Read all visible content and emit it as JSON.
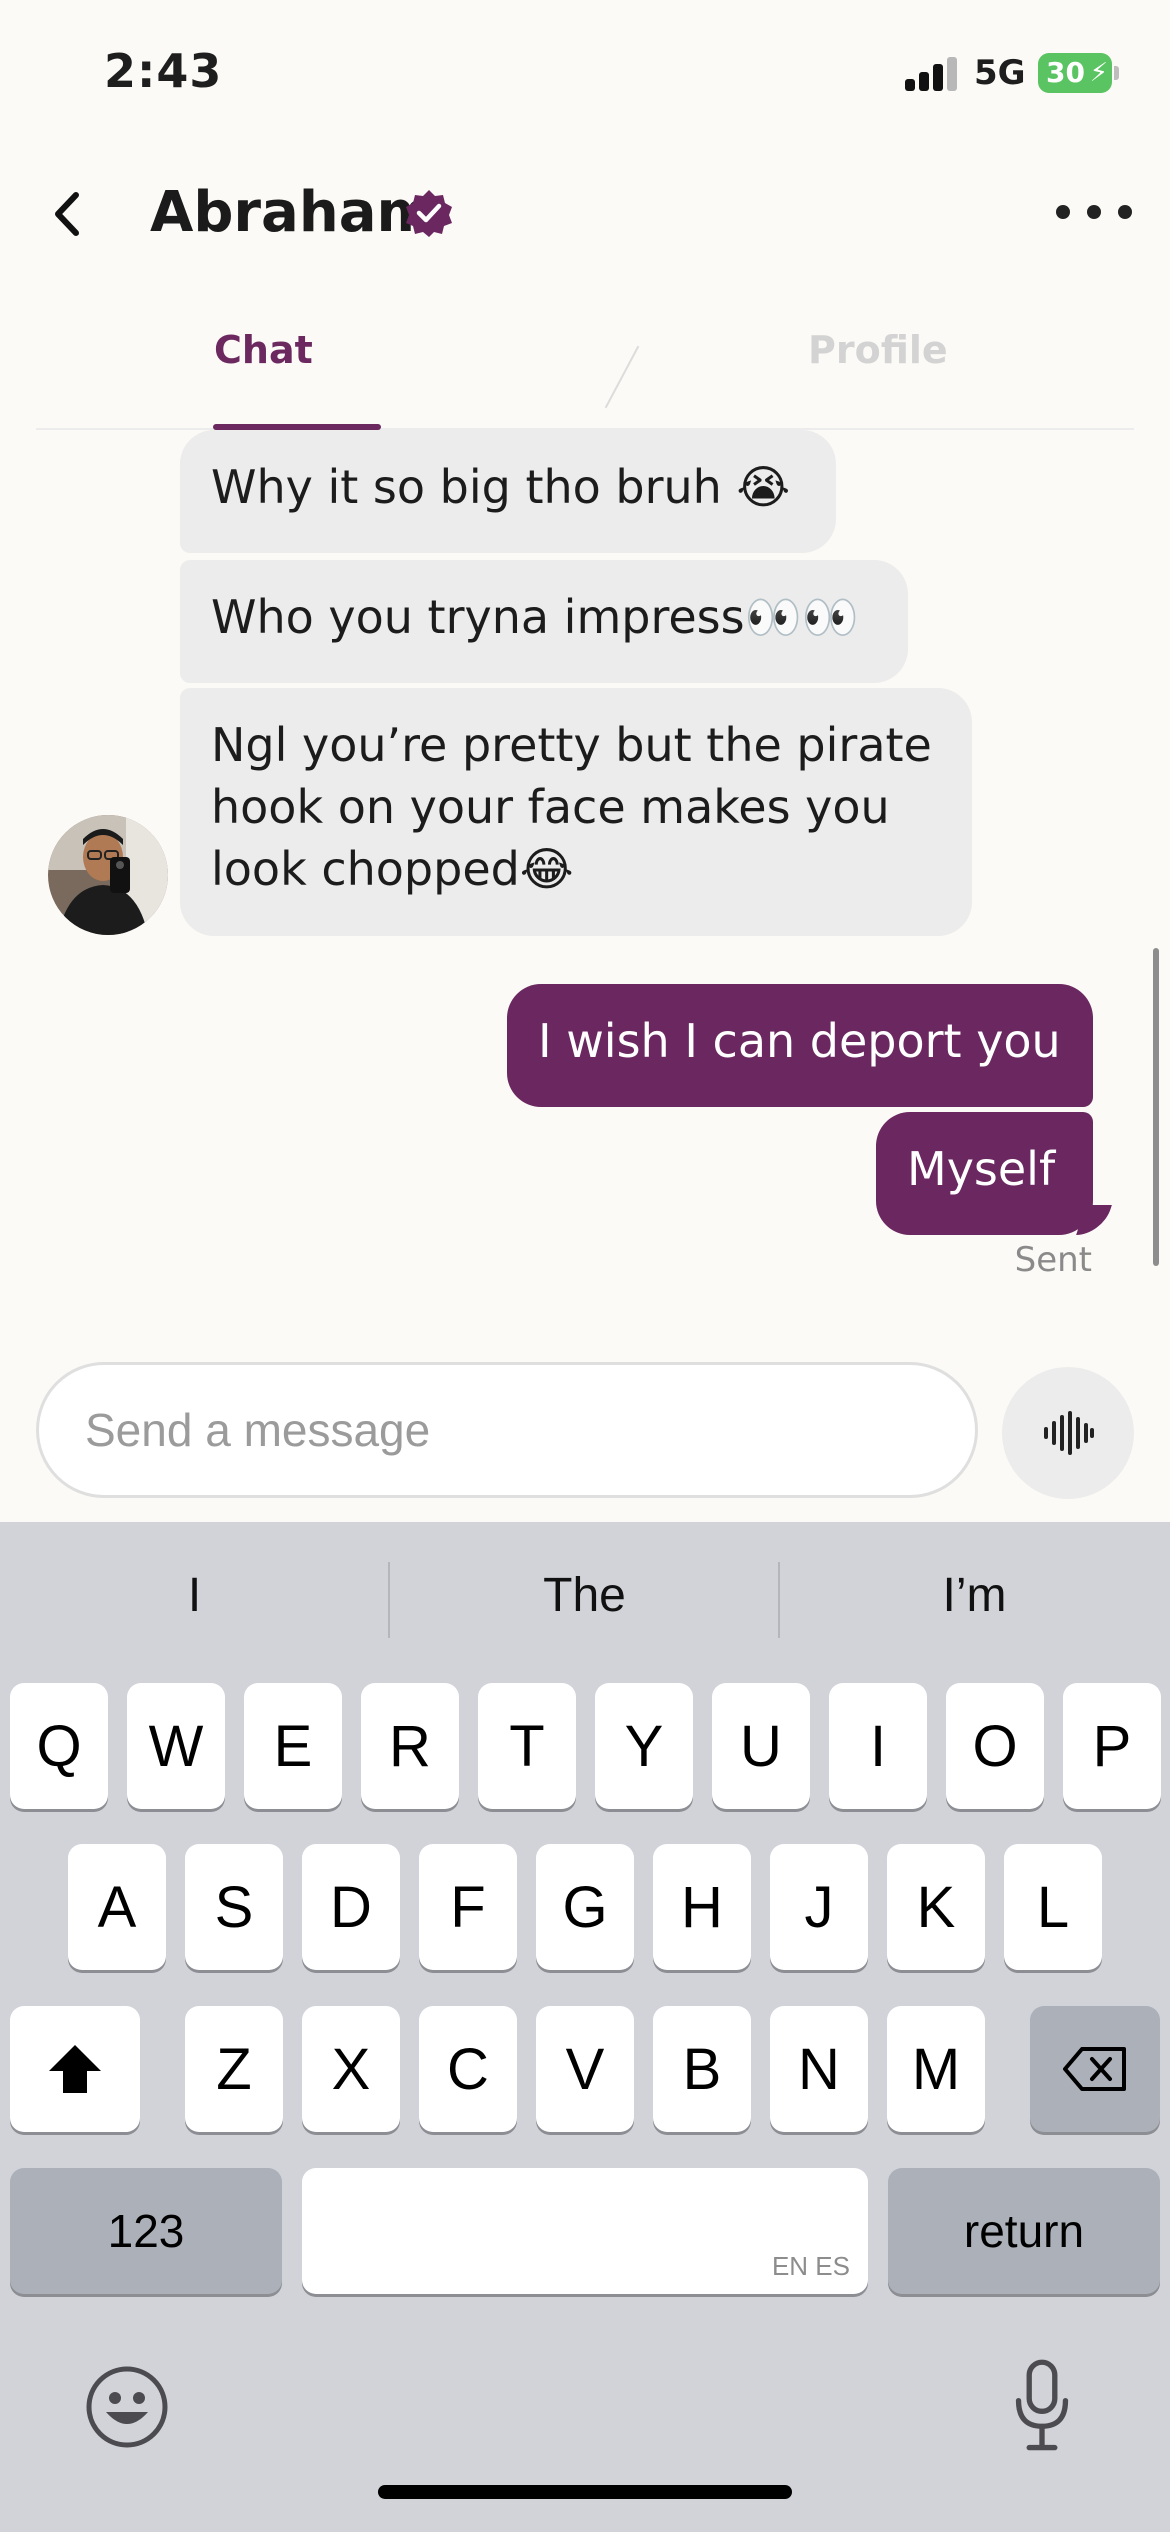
{
  "status_bar": {
    "time": "2:43",
    "network": "5G",
    "battery": "30",
    "battery_charging": true
  },
  "header": {
    "contact_name": "Abraham",
    "verified": true,
    "back_icon": "chevron-left-icon",
    "more_icon": "more-horizontal-icon"
  },
  "tabs": [
    {
      "label": "Chat",
      "active": true
    },
    {
      "label": "Profile",
      "active": false
    }
  ],
  "messages": [
    {
      "direction": "incoming",
      "text": "Why it so big tho bruh 😭"
    },
    {
      "direction": "incoming",
      "text": "Who you tryna impress👀👀"
    },
    {
      "direction": "incoming",
      "text": "Ngl you’re pretty but the pirate hook on your face makes you look chopped😂"
    },
    {
      "direction": "outgoing",
      "text": "I wish I can deport you"
    },
    {
      "direction": "outgoing",
      "text": "Myself"
    }
  ],
  "delivery_status": "Sent",
  "composer": {
    "placeholder": "Send a message",
    "voice_icon": "voice-waveform-icon"
  },
  "keyboard": {
    "suggestions": [
      "I",
      "The",
      "I’m"
    ],
    "row1": [
      "Q",
      "W",
      "E",
      "R",
      "T",
      "Y",
      "U",
      "I",
      "O",
      "P"
    ],
    "row2": [
      "A",
      "S",
      "D",
      "F",
      "G",
      "H",
      "J",
      "K",
      "L"
    ],
    "row3": [
      "Z",
      "X",
      "C",
      "V",
      "B",
      "N",
      "M"
    ],
    "numbers_label": "123",
    "return_label": "return",
    "space_language": "EN ES"
  },
  "colors": {
    "accent": "#6a2760",
    "incoming_bubble": "#ececec",
    "keyboard_bg": "#d1d3d9"
  }
}
